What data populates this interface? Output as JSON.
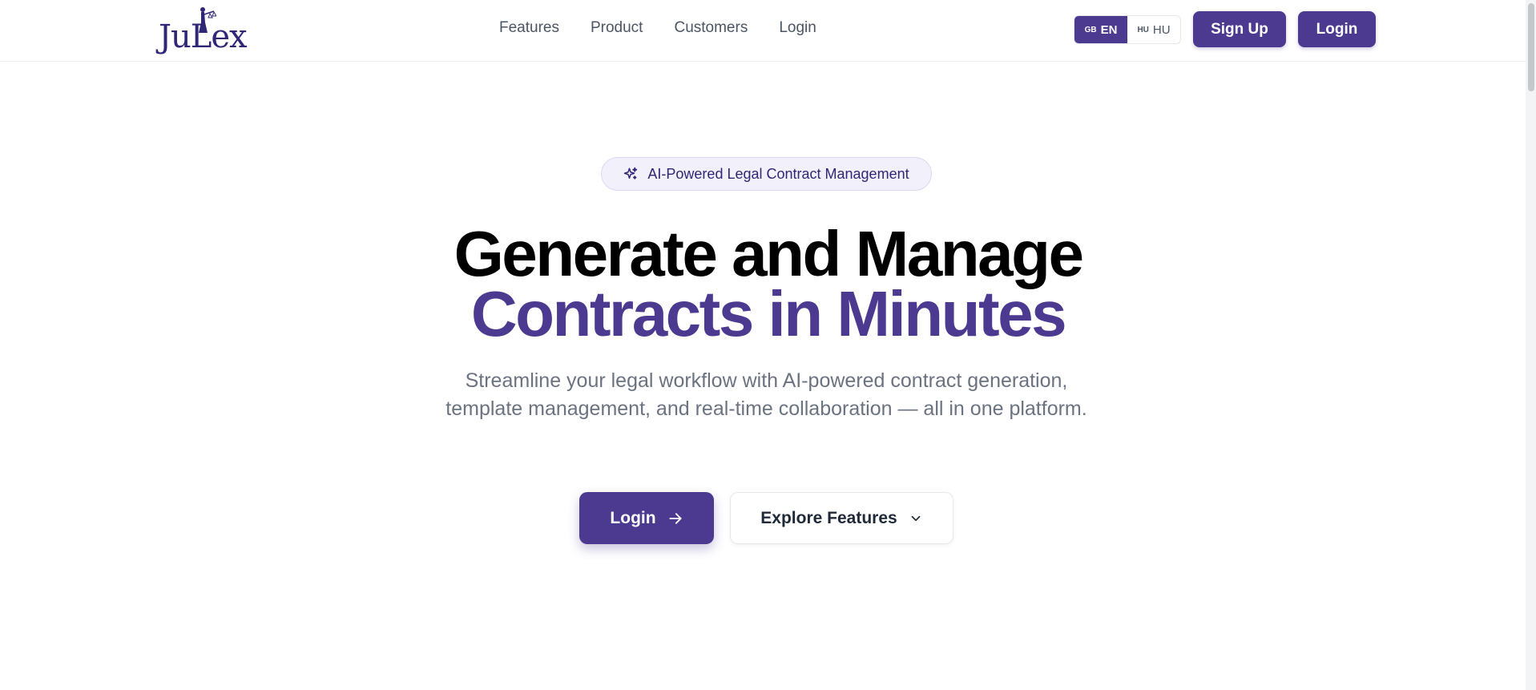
{
  "header": {
    "logo_text": "JuLex",
    "nav": [
      {
        "label": "Features"
      },
      {
        "label": "Product"
      },
      {
        "label": "Customers"
      },
      {
        "label": "Login"
      }
    ],
    "language": {
      "options": [
        {
          "flag_code": "GB",
          "label": "EN",
          "selected": true
        },
        {
          "flag_code": "HU",
          "label": "HU",
          "selected": false
        }
      ]
    },
    "signup_label": "Sign Up",
    "login_label": "Login"
  },
  "hero": {
    "badge_icon": "sparkles-icon",
    "badge_text": "AI-Powered Legal Contract Management",
    "headline_line1": "Generate and Manage",
    "headline_line2": "Contracts in Minutes",
    "subtitle": "Streamline your legal workflow with AI-powered contract generation, template management, and real-time collaboration — all in one platform.",
    "cta_primary": {
      "label": "Login",
      "icon": "arrow-right-icon"
    },
    "cta_secondary": {
      "label": "Explore Features",
      "icon": "chevron-down-icon"
    }
  },
  "colors": {
    "brand": "#4b3a8f",
    "brand_dark": "#2f2676",
    "text_muted": "#6b7280"
  }
}
